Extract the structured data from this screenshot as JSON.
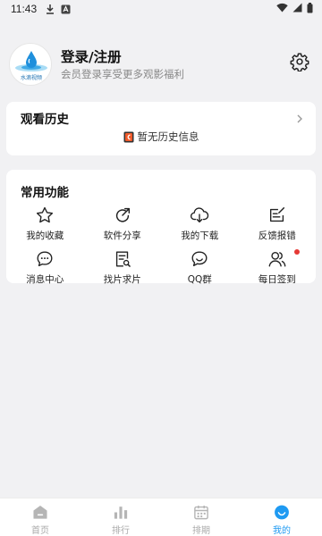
{
  "status_bar": {
    "time": "11:43"
  },
  "profile": {
    "avatar_text": "水滴视频",
    "title": "登录/注册",
    "subtitle": "会员登录享受更多观影福利"
  },
  "history": {
    "title": "观看历史",
    "empty_text": "暂无历史信息"
  },
  "features": {
    "title": "常用功能",
    "items": [
      {
        "label": "我的收藏",
        "icon": "star-icon"
      },
      {
        "label": "软件分享",
        "icon": "share-icon"
      },
      {
        "label": "我的下载",
        "icon": "cloud-download-icon"
      },
      {
        "label": "反馈报错",
        "icon": "feedback-icon"
      },
      {
        "label": "消息中心",
        "icon": "message-icon"
      },
      {
        "label": "找片求片",
        "icon": "search-film-icon"
      },
      {
        "label": "QQ群",
        "icon": "chat-group-icon"
      },
      {
        "label": "每日签到",
        "icon": "users-icon",
        "badge": true
      }
    ]
  },
  "tabs": [
    {
      "label": "首页",
      "icon": "home-icon",
      "active": false
    },
    {
      "label": "排行",
      "icon": "ranking-icon",
      "active": false
    },
    {
      "label": "排期",
      "icon": "calendar-icon",
      "active": false
    },
    {
      "label": "我的",
      "icon": "smile-icon",
      "active": true
    }
  ],
  "colors": {
    "accent": "#1e9af2",
    "badge": "#e53935",
    "background": "#f1f1f3"
  }
}
